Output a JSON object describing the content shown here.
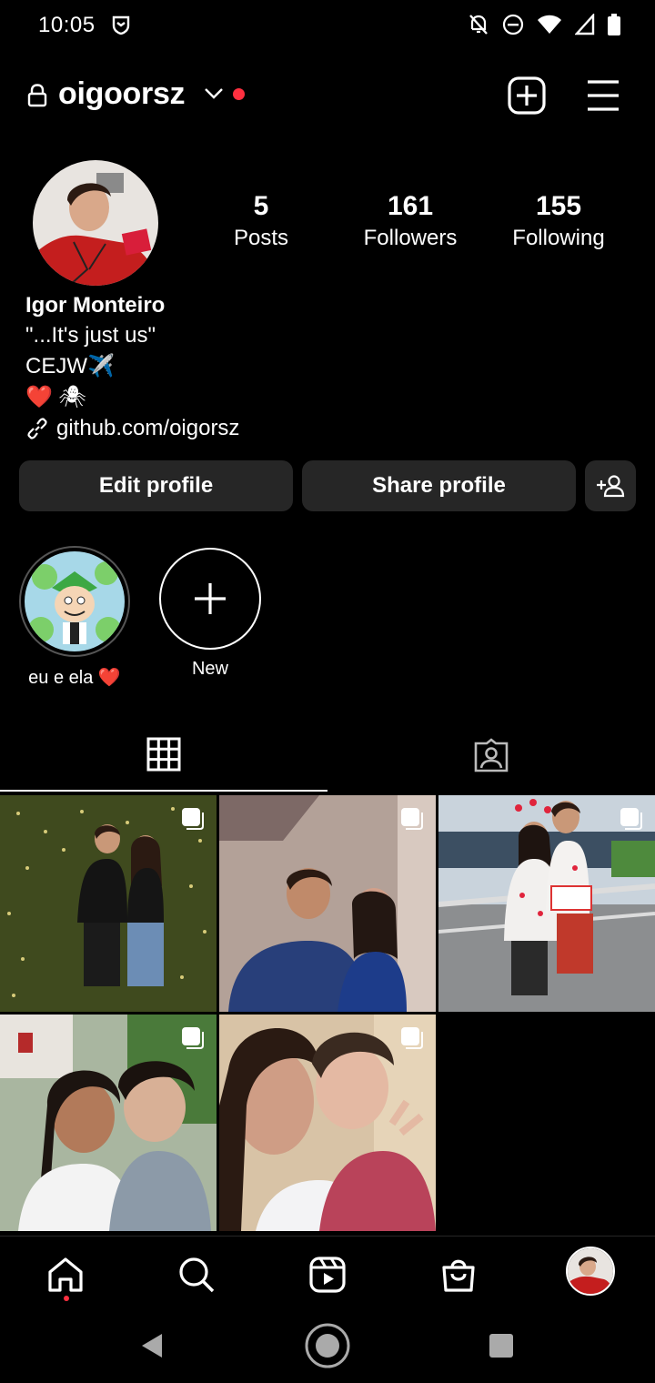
{
  "status_bar": {
    "time": "10:05"
  },
  "header": {
    "username": "oigoorsz"
  },
  "profile": {
    "stats": [
      {
        "value": "5",
        "label": "Posts"
      },
      {
        "value": "161",
        "label": "Followers"
      },
      {
        "value": "155",
        "label": "Following"
      }
    ],
    "name": "Igor Monteiro",
    "bio_lines": [
      "\"...It's just us\"",
      "CEJW✈️",
      "❤️ 🕷"
    ],
    "link": "github.com/oigorsz"
  },
  "buttons": {
    "edit": "Edit profile",
    "share": "Share profile"
  },
  "highlights": [
    {
      "label": "eu e ela ❤️"
    },
    {
      "label": "New"
    }
  ],
  "tabs": [
    {
      "icon": "grid-icon",
      "selected": true
    },
    {
      "icon": "tagged-icon",
      "selected": false
    }
  ],
  "posts_count": 5,
  "bottom_nav": [
    "home-icon",
    "search-icon",
    "reels-icon",
    "shop-icon",
    "profile-avatar"
  ],
  "colors": {
    "background": "#000000",
    "button": "#262626",
    "notification": "#ff3040"
  }
}
